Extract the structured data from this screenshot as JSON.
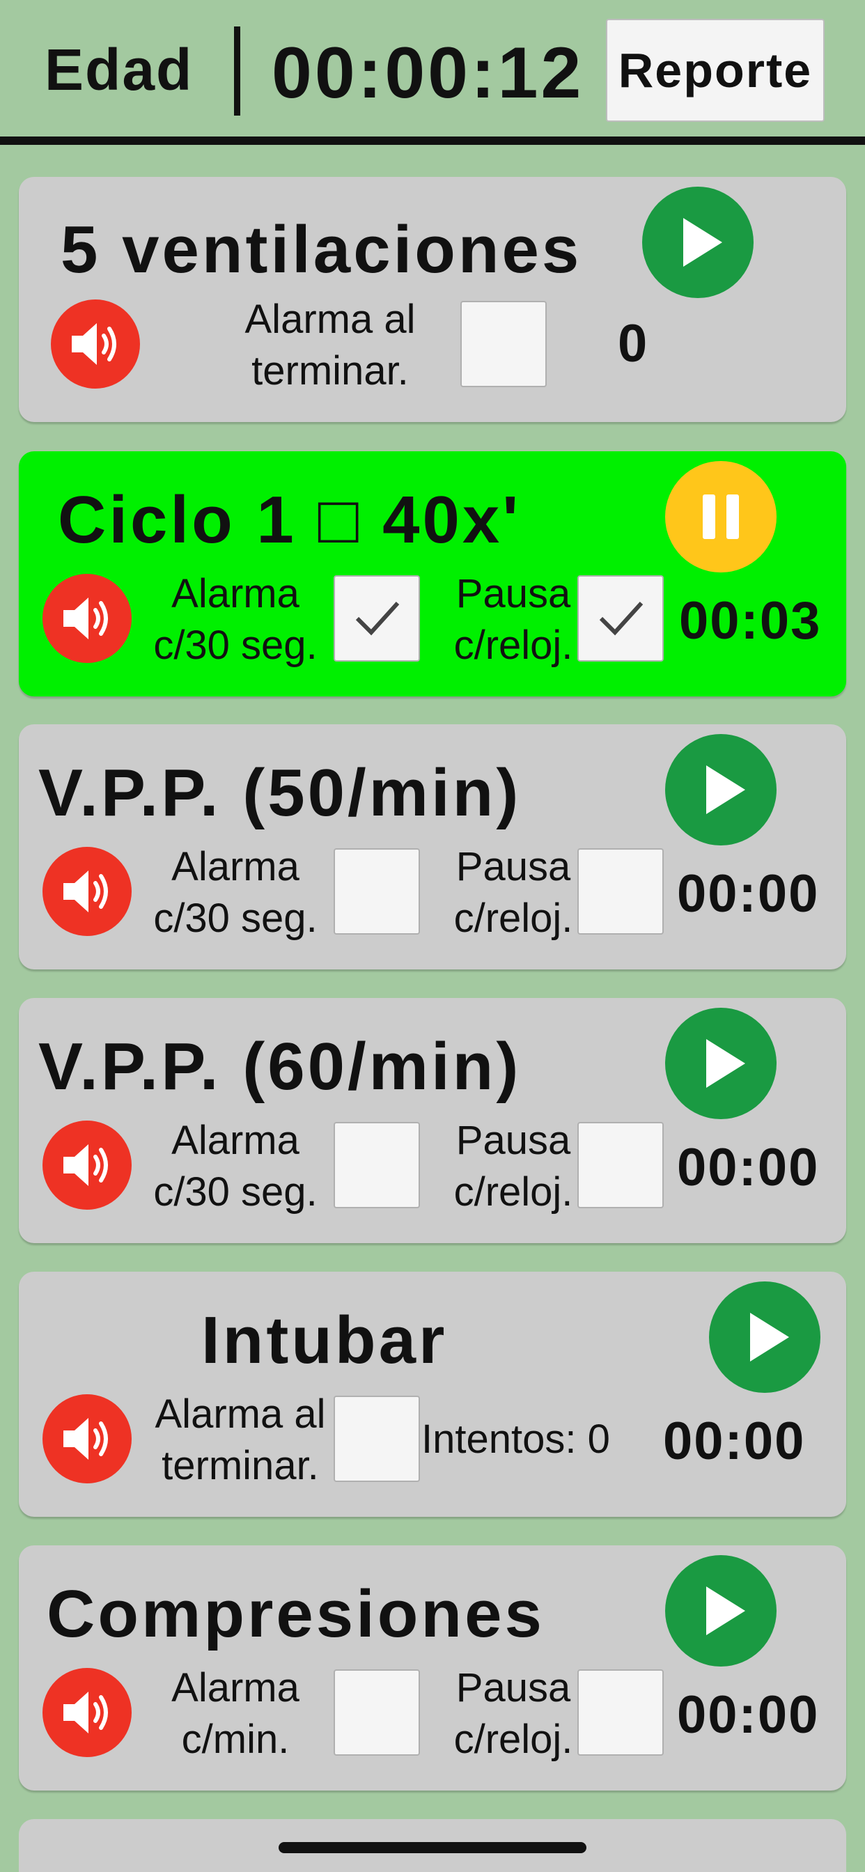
{
  "header": {
    "edad_label": "Edad",
    "timer": "00:00:12",
    "report_button": "Reporte"
  },
  "colors": {
    "background": "#a3c9a0",
    "card": "#cccccc",
    "active_card": "#00f000",
    "play": "#1a9a42",
    "pause": "#ffc61a",
    "speaker": "#ee3224"
  },
  "cards": [
    {
      "title": "5 ventilaciones",
      "state": "play",
      "label1": [
        "Alarma al",
        "terminar."
      ],
      "checked1": false,
      "value": "0"
    },
    {
      "title": "Ciclo 1 □ 40x'",
      "state": "pause",
      "label1": [
        "Alarma",
        "c/30 seg."
      ],
      "checked1": true,
      "label2": [
        "Pausa",
        "c/reloj."
      ],
      "checked2": true,
      "value": "00:03"
    },
    {
      "title": "V.P.P. (50/min)",
      "state": "play",
      "label1": [
        "Alarma",
        "c/30 seg."
      ],
      "checked1": false,
      "label2": [
        "Pausa",
        "c/reloj."
      ],
      "checked2": false,
      "value": "00:00"
    },
    {
      "title": "V.P.P. (60/min)",
      "state": "play",
      "label1": [
        "Alarma",
        "c/30 seg."
      ],
      "checked1": false,
      "label2": [
        "Pausa",
        "c/reloj."
      ],
      "checked2": false,
      "value": "00:00"
    },
    {
      "title": "Intubar",
      "state": "play",
      "label1": [
        "Alarma al",
        "terminar."
      ],
      "checked1": false,
      "attempts": "Intentos: 0",
      "value": "00:00"
    },
    {
      "title": "Compresiones",
      "state": "play",
      "label1": [
        "Alarma",
        "c/min."
      ],
      "checked1": false,
      "label2": [
        "Pausa",
        "c/reloj."
      ],
      "checked2": false,
      "value": "00:00"
    }
  ]
}
